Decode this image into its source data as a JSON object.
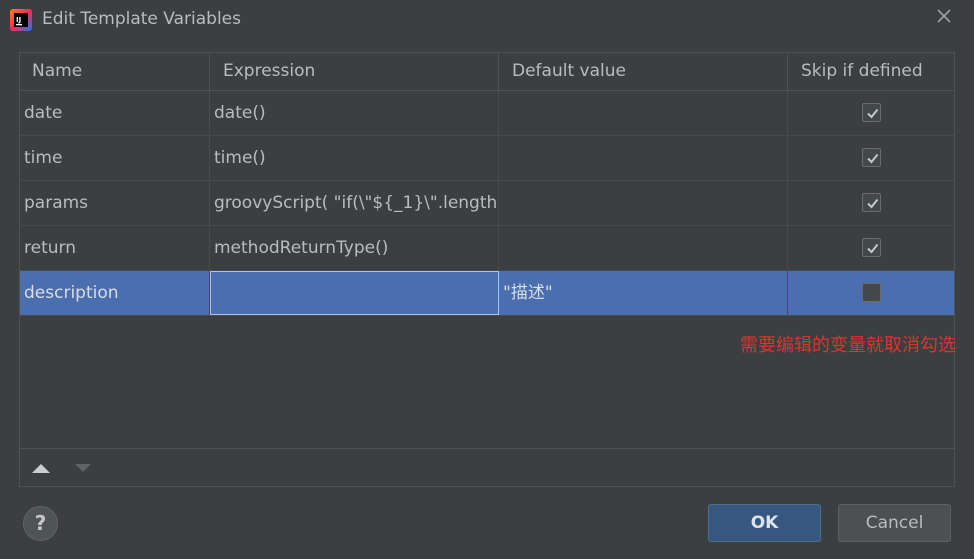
{
  "window": {
    "title": "Edit Template Variables",
    "app_icon": "intellij-idea-icon"
  },
  "table": {
    "columns": [
      "Name",
      "Expression",
      "Default value",
      "Skip if defined"
    ],
    "rows": [
      {
        "name": "date",
        "expression": "date()",
        "default_value": "",
        "skip_if_defined": true
      },
      {
        "name": "time",
        "expression": "time()",
        "default_value": "",
        "skip_if_defined": true
      },
      {
        "name": "params",
        "expression": "groovyScript( \"if(\\\"${_1}\\\".length…",
        "default_value": "",
        "skip_if_defined": true
      },
      {
        "name": "return",
        "expression": "methodReturnType()",
        "default_value": "",
        "skip_if_defined": true
      },
      {
        "name": "description",
        "expression": "",
        "default_value": "\"描述\"",
        "skip_if_defined": false,
        "selected": true,
        "editing_column": "expression"
      }
    ]
  },
  "toolbar": {
    "move_up_icon": "arrow-up-icon",
    "move_down_icon": "arrow-down-icon"
  },
  "annotation": "需要编辑的变量就取消勾选",
  "buttons": {
    "help": "?",
    "ok": "OK",
    "cancel": "Cancel"
  },
  "colors": {
    "selection": "#4b6eaf",
    "annotation": "#e0322e",
    "ok_button": "#365880"
  }
}
